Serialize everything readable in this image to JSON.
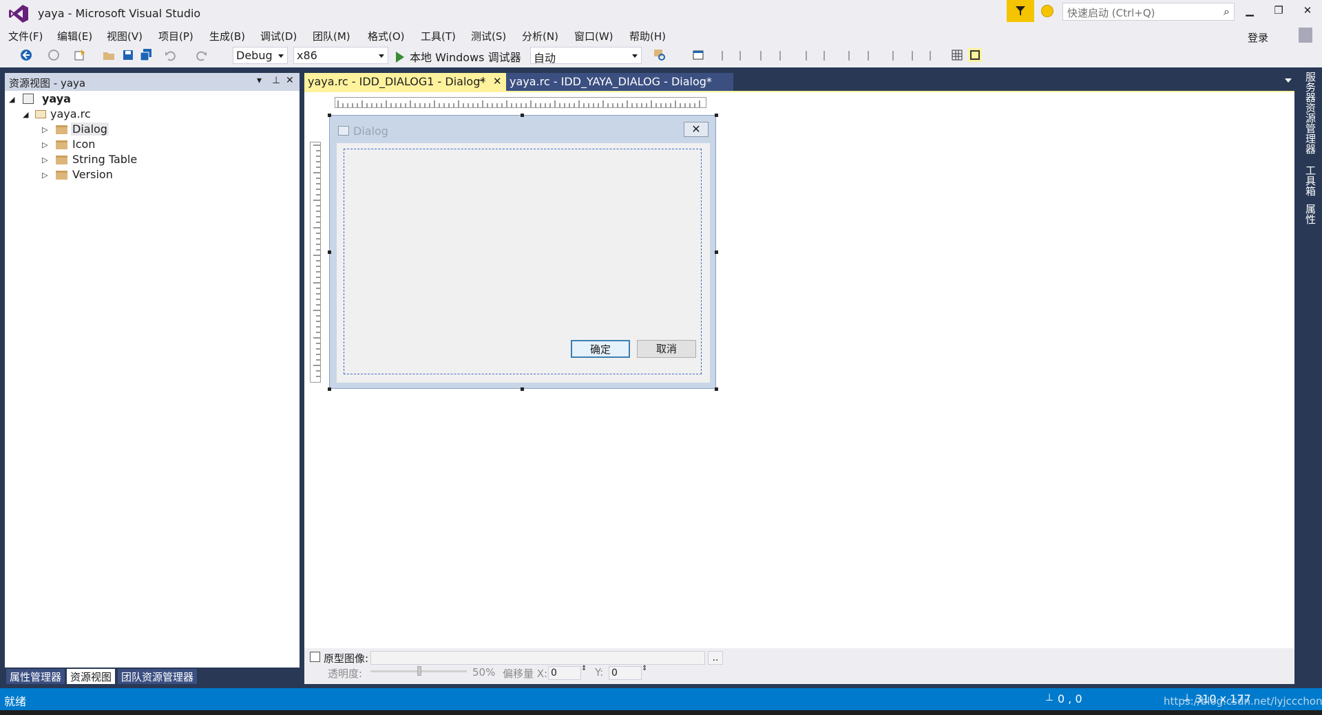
{
  "window": {
    "title": "yaya - Microsoft Visual Studio",
    "quick_launch_placeholder": "快速启动 (Ctrl+Q)",
    "login_label": "登录",
    "minimize_glyph": "▁",
    "restore_glyph": "❐",
    "close_glyph": "✕"
  },
  "menu": [
    "文件(F)",
    "编辑(E)",
    "视图(V)",
    "项目(P)",
    "生成(B)",
    "调试(D)",
    "团队(M)",
    "格式(O)",
    "工具(T)",
    "测试(S)",
    "分析(N)",
    "窗口(W)",
    "帮助(H)"
  ],
  "toolbar": {
    "config": "Debug",
    "platform": "x86",
    "run_label": "本地 Windows 调试器",
    "run_mode": "自动"
  },
  "resource_view": {
    "header": "资源视图 - yaya",
    "root": "yaya",
    "rc_file": "yaya.rc",
    "items": [
      "Dialog",
      "Icon",
      "String Table",
      "Version"
    ]
  },
  "bottom_tabs": [
    "属性管理器",
    "资源视图",
    "团队资源管理器"
  ],
  "doc_tabs": {
    "active": "yaya.rc - IDD_DIALOG1 - Dialog*",
    "inactive": "yaya.rc - IDD_YAYA_DIALOG - Dialog*"
  },
  "dialog": {
    "title": "Dialog",
    "ok_label": "确定",
    "cancel_label": "取消",
    "close_glyph": "✕"
  },
  "proto_bar": {
    "checkbox_label": "原型图像:",
    "browse_label": "..",
    "opacity_label": "透明度:",
    "opacity_value": "50%",
    "offset_label": "偏移量 X:",
    "offset_x": "0",
    "y_label": "Y:",
    "offset_y": "0"
  },
  "right_tabs": [
    "服务器资源管理器",
    "工具箱",
    "属性"
  ],
  "status": {
    "ready": "就绪",
    "position": "0 , 0",
    "size": "310 x 177",
    "watermark": "https://blog.csdn.net/lyjccchong"
  },
  "colors": {
    "accent": "#007acc",
    "chrome": "#eeeef2",
    "frame": "#293955",
    "active_tab": "#fff29d"
  }
}
